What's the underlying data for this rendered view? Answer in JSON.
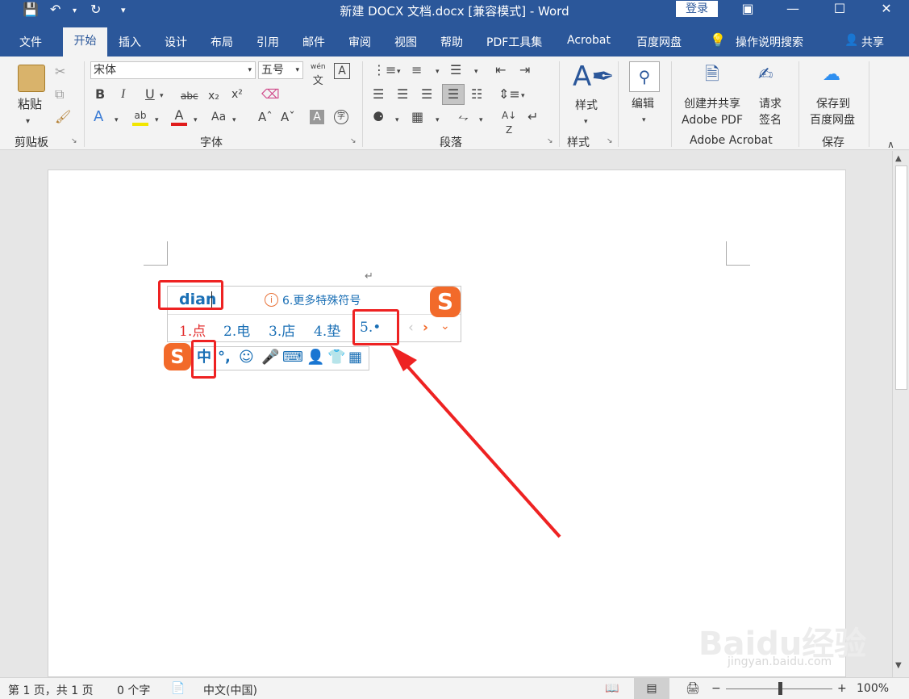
{
  "titlebar": {
    "title": "新建 DOCX 文档.docx [兼容模式]  -  Word",
    "login": "登录"
  },
  "tabs": [
    "文件",
    "开始",
    "插入",
    "设计",
    "布局",
    "引用",
    "邮件",
    "审阅",
    "视图",
    "帮助",
    "PDF工具集",
    "Acrobat",
    "百度网盘"
  ],
  "tell_me": "操作说明搜索",
  "share": "共享",
  "clipboard": {
    "paste": "粘贴",
    "label": "剪贴板"
  },
  "font": {
    "name": "宋体",
    "size": "五号",
    "label": "字体",
    "wen": "wén",
    "wen_char": "文",
    "abc": "abc",
    "aa": "Aa"
  },
  "paragraph": {
    "label": "段落"
  },
  "styles": {
    "button": "样式",
    "label": "样式"
  },
  "editing": {
    "button": "编辑"
  },
  "adobe": {
    "create_line1": "创建并共享",
    "create_line2": "Adobe PDF",
    "request_line1": "请求",
    "request_line2": "签名",
    "label": "Adobe Acrobat"
  },
  "save": {
    "line1": "保存到",
    "line2": "百度网盘",
    "label": "保存"
  },
  "ime": {
    "input": "dian",
    "more": "6.更多特殊符号",
    "candidates": [
      "1.点",
      "2.电",
      "3.店",
      "4.垫",
      "5.•"
    ],
    "mode": "中",
    "punct": "°,"
  },
  "status": {
    "page": "第 1 页，共 1 页",
    "words": "0 个字",
    "lang": "中文(中国)",
    "zoom": "100%"
  },
  "watermark": {
    "brand": "Baidu经验",
    "url": "jingyan.baidu.com"
  },
  "colors": {
    "accent": "#2b579a",
    "highlight": "#ee2222",
    "ime_blue": "#1a6fb5"
  }
}
